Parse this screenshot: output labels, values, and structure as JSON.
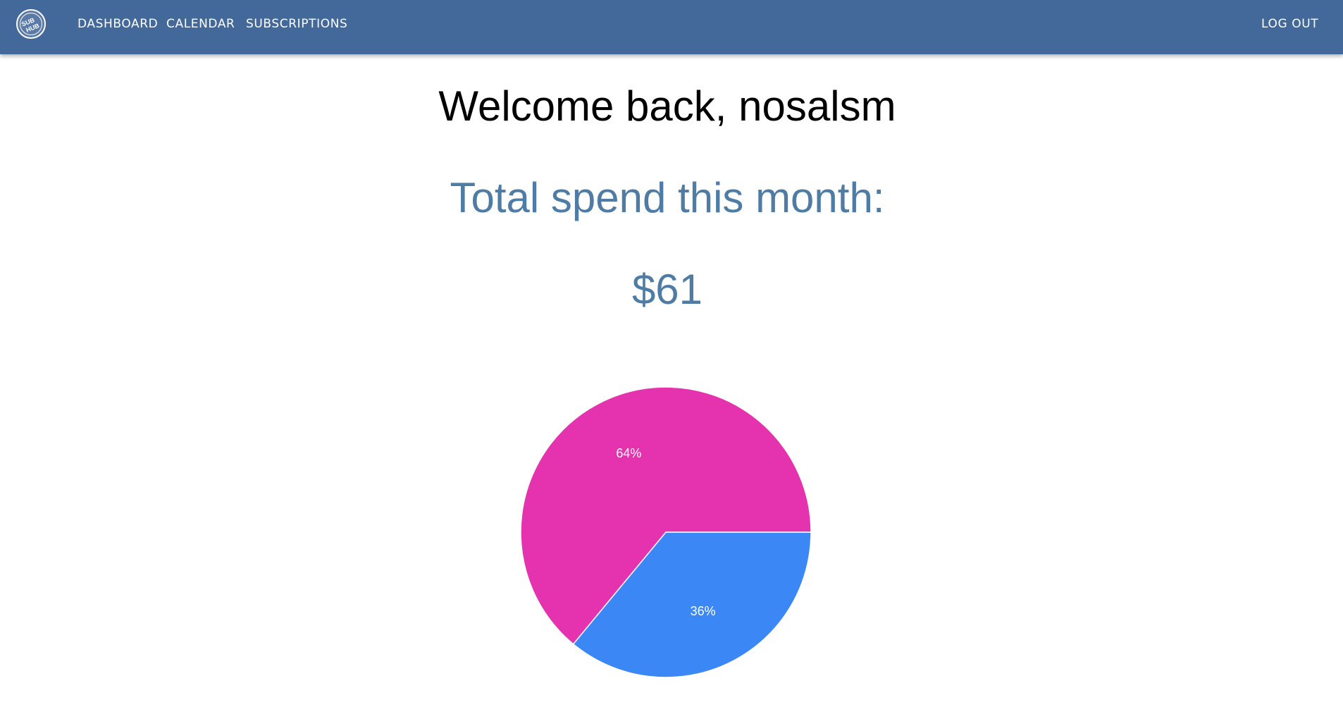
{
  "app": {
    "logo_line1": "SUB",
    "logo_line2": "HUB"
  },
  "nav": {
    "items": [
      {
        "label": "DASHBOARD"
      },
      {
        "label": "CALENDAR"
      },
      {
        "label": "SUBSCRIPTIONS"
      }
    ],
    "logout_label": "LOG OUT"
  },
  "main": {
    "greeting": "Welcome back, nosalsm",
    "spend_label": "Total spend this month:",
    "spend_value": "$61"
  },
  "colors": {
    "navbar": "#43699a",
    "accent_text": "#4f7ca5",
    "slice_1": "#e532ae",
    "slice_2": "#3b87f5"
  },
  "chart_data": {
    "type": "pie",
    "values": [
      64,
      36
    ],
    "labels": [
      "64%",
      "36%"
    ],
    "colors": [
      "#e532ae",
      "#3b87f5"
    ]
  }
}
